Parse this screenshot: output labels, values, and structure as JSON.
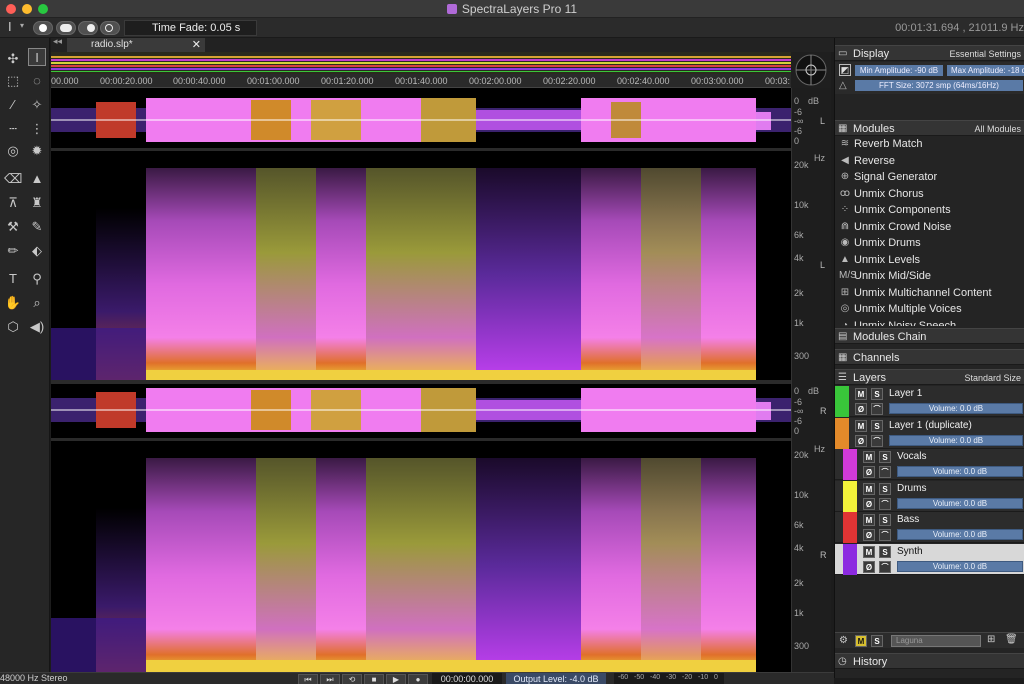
{
  "app": {
    "title": "SpectraLayers Pro 11"
  },
  "toolbar": {
    "time_fade": "Time Fade: 0.05 s",
    "readout": "00:01:31.694 , 21011.9 Hz"
  },
  "tab": {
    "name": "radio.slp*",
    "close": "✕"
  },
  "ruler": {
    "ticks": [
      "00.000",
      "00:00:20.000",
      "00:00:40.000",
      "00:01:00.000",
      "00:01:20.000",
      "00:01:40.000",
      "00:02:00.000",
      "00:02:20.000",
      "00:02:40.000",
      "00:03:00.000",
      "00:03:"
    ]
  },
  "scales": {
    "db_top": [
      "0",
      "-6",
      "-∞",
      "-6",
      "0"
    ],
    "db_unit": "dB",
    "hz_unit": "Hz",
    "hz_ticks": [
      "20k",
      "10k",
      "6k",
      "4k",
      "2k",
      "1k",
      "300"
    ],
    "channel_left": "L",
    "channel_right": "R"
  },
  "panels": {
    "display": {
      "title": "Display",
      "preset": "Essential Settings",
      "min_amp": "Min Amplitude: -90 dB",
      "max_amp": "Max Amplitude: -18 dB",
      "fft": "FFT Size: 3072 smp (64ms/16Hz)"
    },
    "modules": {
      "title": "Modules",
      "filter": "All Modules",
      "items": [
        "Reverb Match",
        "Reverse",
        "Signal Generator",
        "Unmix Chorus",
        "Unmix Components",
        "Unmix Crowd Noise",
        "Unmix Drums",
        "Unmix Levels",
        "Unmix Mid/Side",
        "Unmix Multichannel Content",
        "Unmix Multiple Voices",
        "Unmix Noisy Speech"
      ],
      "icons": [
        "≋",
        "◀",
        "⊕",
        "ꝏ",
        "⁘",
        "⋒",
        "◉",
        "▲",
        "M/S",
        "⊞",
        "◎",
        "◔"
      ]
    },
    "modules_chain": {
      "title": "Modules Chain"
    },
    "channels": {
      "title": "Channels"
    },
    "layers": {
      "title": "Layers",
      "size": "Standard Size",
      "items": [
        {
          "name": "Layer 1",
          "volume": "Volume: 0.0 dB",
          "color": "#39c63a"
        },
        {
          "name": "Layer 1 (duplicate)",
          "volume": "Volume: 0.0 dB",
          "color": "#e38a2a"
        },
        {
          "name": "Vocals",
          "volume": "Volume: 0.0 dB",
          "color": "#d23ad8"
        },
        {
          "name": "Drums",
          "volume": "Volume: 0.0 dB",
          "color": "#f2f23a"
        },
        {
          "name": "Bass",
          "volume": "Volume: 0.0 dB",
          "color": "#e03434"
        },
        {
          "name": "Synth",
          "volume": "Volume: 0.0 dB",
          "color": "#8c2ae0"
        }
      ],
      "m": "M",
      "s": "S",
      "preset": "Laguna"
    },
    "history": {
      "title": "History"
    }
  },
  "status": {
    "format": "48000 Hz Stereo",
    "time": "00:00:00.000",
    "output_level": "Output Level: -4.0 dB",
    "meter": [
      "-60",
      "-50",
      "-40",
      "-30",
      "-20",
      "-10",
      "0"
    ]
  },
  "colors": {
    "accent": "#5a7aa6",
    "spectro_magenta": "#f07cf0",
    "spectro_olive": "#8a8a2a"
  }
}
